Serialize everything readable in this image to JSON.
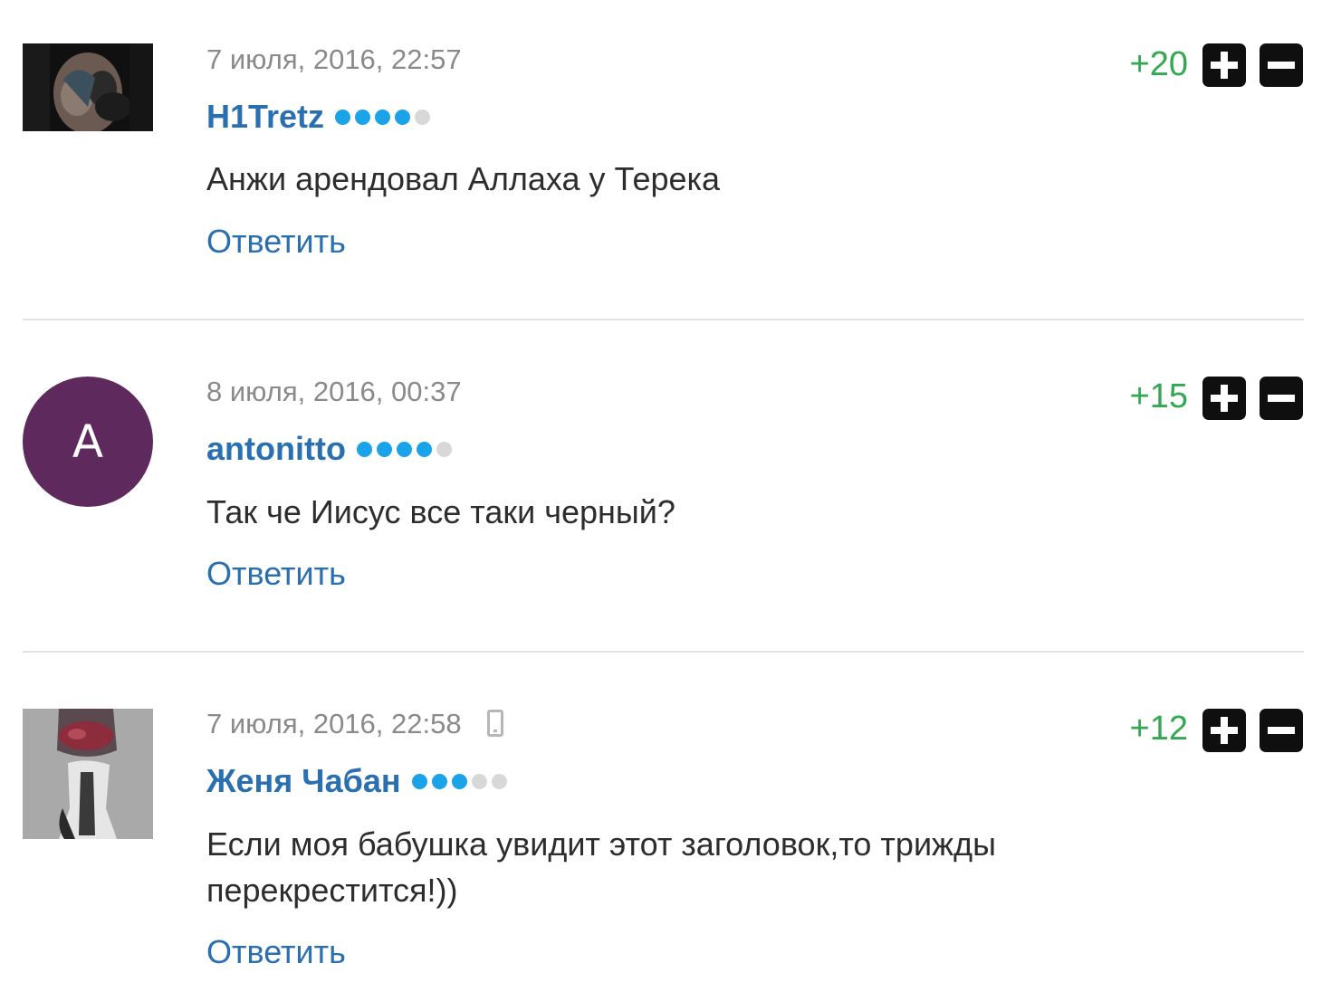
{
  "colors": {
    "author": "#2a6fb0",
    "reply": "#2a6fb0",
    "score_positive": "#32a852",
    "date": "#8a8a8a",
    "rating_on": "#1aa3e8",
    "rating_off": "#d8d8d8",
    "avatar_letter_bg": "#5e2a5e"
  },
  "comments": [
    {
      "date": "7 июля, 2016, 22:57",
      "author": "H1Tretz",
      "rating_dots": {
        "filled": 4,
        "total": 5
      },
      "text": "Анжи арендовал Аллаха у Терека",
      "reply_label": "Ответить",
      "score": "+20",
      "avatar": {
        "type": "photo",
        "icon": "user-photo-avatar"
      }
    },
    {
      "date": "8 июля, 2016, 00:37",
      "author": "antonitto",
      "rating_dots": {
        "filled": 4,
        "total": 5
      },
      "text": "Так че Иисус все таки черный?",
      "reply_label": "Ответить",
      "score": "+15",
      "avatar": {
        "type": "letter",
        "letter": "A"
      }
    },
    {
      "date": "7 июля, 2016, 22:58",
      "device_icon": "mobile-device-icon",
      "author": "Женя Чабан",
      "rating_dots": {
        "filled": 3,
        "total": 5
      },
      "text": "Если моя бабушка увидит этот заголовок,то трижды перекрестится!))",
      "reply_label": "Ответить",
      "score": "+12",
      "avatar": {
        "type": "photo",
        "icon": "user-photo-avatar"
      }
    }
  ]
}
